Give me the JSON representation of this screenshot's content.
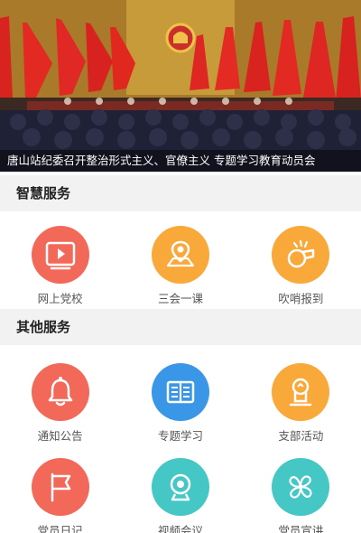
{
  "banner": {
    "caption": "唐山站纪委召开整治形式主义、官僚主义 专题学习教育动员会"
  },
  "sections": [
    {
      "title": "智慧服务",
      "items": [
        {
          "label": "网上党校",
          "icon": "video-icon",
          "color": "#f2695a"
        },
        {
          "label": "三会一课",
          "icon": "map-pin-icon",
          "color": "#f8a93a"
        },
        {
          "label": "吹哨报到",
          "icon": "whistle-icon",
          "color": "#f8a93a"
        }
      ]
    },
    {
      "title": "其他服务",
      "items": [
        {
          "label": "通知公告",
          "icon": "bell-icon",
          "color": "#f2695a"
        },
        {
          "label": "专题学习",
          "icon": "book-icon",
          "color": "#3a97e8"
        },
        {
          "label": "支部活动",
          "icon": "activity-icon",
          "color": "#f8a93a"
        },
        {
          "label": "党员日记",
          "icon": "flag-icon",
          "color": "#f2695a"
        },
        {
          "label": "视频会议",
          "icon": "webcam-icon",
          "color": "#45c7c6"
        },
        {
          "label": "党员宣讲",
          "icon": "fan-icon",
          "color": "#45c7c6"
        }
      ]
    }
  ]
}
